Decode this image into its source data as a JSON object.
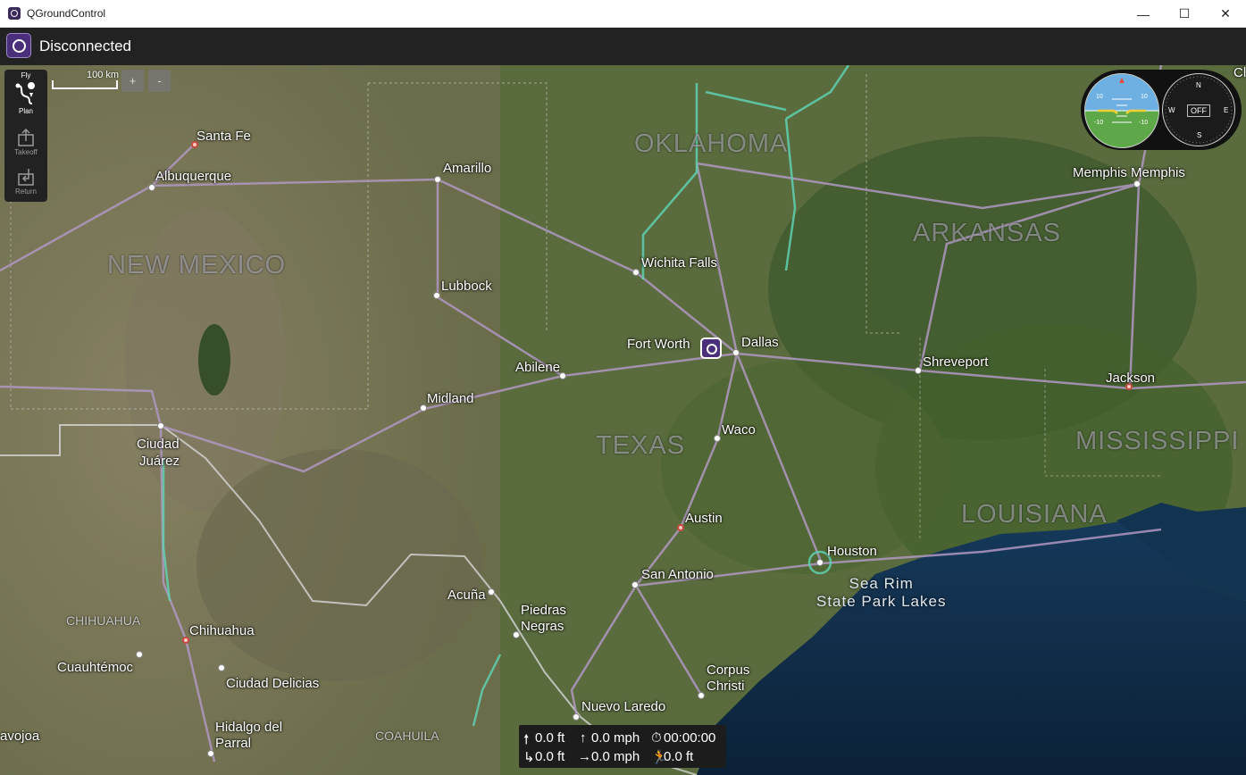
{
  "window": {
    "title": "QGroundControl",
    "controls": {
      "minimize": "—",
      "maximize": "☐",
      "close": "✕"
    }
  },
  "toolbar": {
    "connection_status": "Disconnected"
  },
  "fly_tools": [
    {
      "label": "Fly",
      "icon": "fly-icon"
    },
    {
      "label": "Plan",
      "icon": "plan-icon"
    },
    {
      "label": "Takeoff",
      "icon": "takeoff-icon"
    },
    {
      "label": "Return",
      "icon": "return-icon"
    }
  ],
  "map": {
    "scale_label": "100 km",
    "zoom_in": "+",
    "zoom_out": "-",
    "states": [
      "OKLAHOMA",
      "ARKANSAS",
      "NEW MEXICO",
      "TEXAS",
      "MISSISSIPPI",
      "LOUISIANA"
    ],
    "regions": [
      "CHIHUAHUA",
      "COAHUILA"
    ],
    "cities": {
      "santa_fe": "Santa Fe",
      "albuquerque": "Albuquerque",
      "amarillo": "Amarillo",
      "wichita_falls": "Wichita Falls",
      "lubbock": "Lubbock",
      "fort_worth": "Fort Worth",
      "dallas": "Dallas",
      "abilene": "Abilene",
      "midland": "Midland",
      "ciudad_juarez_1": "Ciudad",
      "ciudad_juarez_2": "Juárez",
      "waco": "Waco",
      "austin": "Austin",
      "houston": "Houston",
      "san_antonio": "San Antonio",
      "acuna": "Acuña",
      "piedras_negras_1": "Piedras",
      "piedras_negras_2": "Negras",
      "chihuahua": "Chihuahua",
      "cuauhtemoc": "Cuauhtémoc",
      "ciudad_delicias": "Ciudad Delicias",
      "hidalgo_parral_1": "Hidalgo del",
      "hidalgo_parral_2": "Parral",
      "corpus_christi_1": "Corpus",
      "corpus_christi_2": "Christi",
      "nuevo_laredo": "Nuevo Laredo",
      "navojoa": "avojoa",
      "memphis": "Memphis Memphis",
      "shreveport": "Shreveport",
      "jackson": "Jackson",
      "cl": "Cl"
    },
    "water_label_1": "Sea Rim",
    "water_label_2": "State Park Lakes"
  },
  "instruments": {
    "pitch_ticks": [
      "10",
      "10",
      "-10",
      "-10"
    ],
    "compass": {
      "n": "N",
      "e": "E",
      "s": "S",
      "w": "W",
      "status": "OFF"
    }
  },
  "telemetry": {
    "altitude": "0.0 ft",
    "climb_rate": "0.0 mph",
    "flight_time": "00:00:00",
    "distance_home_alt": "0.0 ft",
    "ground_speed": "0.0 mph",
    "distance_to_home": "0.0 ft"
  },
  "colors": {
    "toolbar_bg": "#222222",
    "accent_purple": "#4a2f7a",
    "highway": "#b098c2",
    "toll_road": "#5fd1b0",
    "water": "#0f2c45"
  }
}
